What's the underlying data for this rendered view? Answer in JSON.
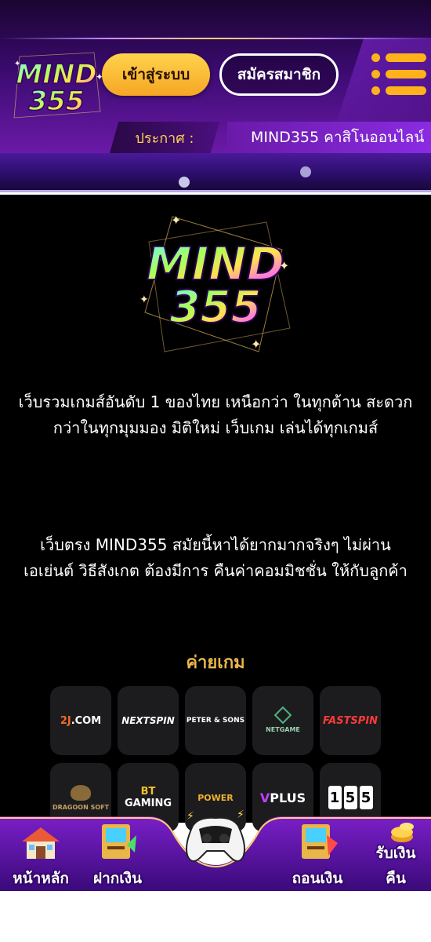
{
  "header": {
    "logo_text_top": "MIND",
    "logo_text_bottom": "355",
    "login_label": "เข้าสู่ระบบ",
    "register_label": "สมัครสมาชิก",
    "announce_label": "ประกาศ :",
    "announce_text": "MIND355 คาสิโนออนไลน์"
  },
  "main": {
    "paragraph1": "เว็บรวมเกมส์อันดับ 1 ของไทย เหนือกว่า ในทุกด้าน สะดวกกว่าในทุกมุมมอง มิติใหม่ เว็บเกม เล่นได้ทุกเกมส์",
    "paragraph2": "เว็บตรง MIND355 สมัยนี้หาได้ยากมากจริงๆ ไม่ผ่านเอเย่นต์ วิธีสังเกต ต้องมีการ คืนค่าคอมมิชชั่น ให้กับลูกค้า",
    "providers_title": "ค่ายเกม",
    "providers": {
      "p1": {
        "a": "2J",
        "b": ".COM"
      },
      "p2": "NEXTSPIN",
      "p3": "PETER & SONS",
      "p4": "NETGAME",
      "p5": "FASTSPIN",
      "p6": "DRAGOON SOFT",
      "p7": {
        "a": "BT",
        "b": " GAMING"
      },
      "p8": "POWER",
      "p9": {
        "a": "V",
        "b": "PLUS"
      },
      "p10": [
        "1",
        "5",
        "5"
      ]
    }
  },
  "bottom_nav": {
    "home": "หน้าหลัก",
    "deposit": "ฝากเงิน",
    "withdraw": "ถอนเงิน",
    "cashback_line1": "รับเงิน",
    "cashback_line2": "คืน"
  },
  "colors": {
    "accent_gold": "#ffb21a",
    "purple": "#6a1aa8",
    "section_title": "#e9b64a"
  }
}
